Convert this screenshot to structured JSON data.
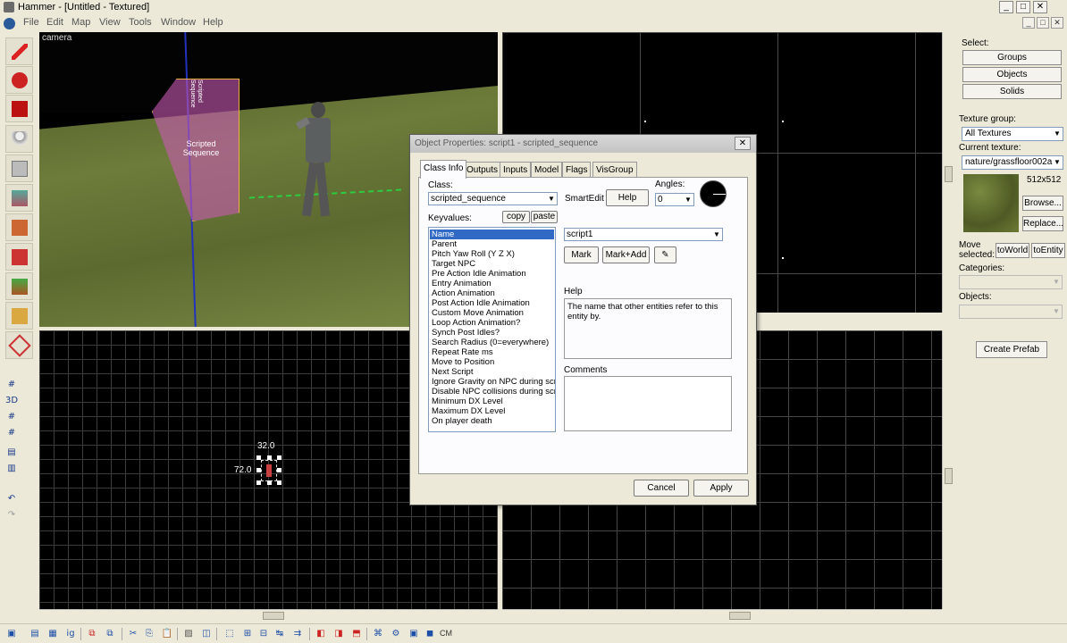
{
  "window": {
    "title": "Hammer - [Untitled - Textured]",
    "controls": {
      "minimize": "_",
      "maximize": "□",
      "close": "✕"
    }
  },
  "menu": [
    "File",
    "Edit",
    "Map",
    "View",
    "Tools",
    "Window",
    "Help"
  ],
  "viewports": {
    "camera_label": "camera",
    "top_view": {
      "width_label": "32.0",
      "height_label": "72.0"
    }
  },
  "entity_box": {
    "line1": "Scripted",
    "line2": "Sequence",
    "top_text": "Scripted Sequence"
  },
  "right_panel": {
    "select_label": "Select:",
    "select_buttons": [
      "Groups",
      "Objects",
      "Solids"
    ],
    "texture_group_label": "Texture group:",
    "texture_group_value": "All Textures",
    "current_texture_label": "Current texture:",
    "current_texture_value": "nature/grassfloor002a",
    "texture_size": "512x512",
    "browse_button": "Browse...",
    "replace_button": "Replace...",
    "move_selected_label": "Move selected:",
    "to_world_button": "toWorld",
    "to_entity_button": "toEntity",
    "categories_label": "Categories:",
    "objects_label": "Objects:",
    "create_prefab_button": "Create Prefab"
  },
  "dialog": {
    "title": "Object Properties: script1 - scripted_sequence",
    "close": "✕",
    "tabs": [
      "Class Info",
      "Outputs",
      "Inputs",
      "Model",
      "Flags",
      "VisGroup"
    ],
    "active_tab": "Class Info",
    "class_label": "Class:",
    "class_value": "scripted_sequence",
    "smartedit_button": "SmartEdit",
    "help_button": "Help",
    "angles_label": "Angles:",
    "angles_value": "0",
    "keyvalues_label": "Keyvalues:",
    "copy_button": "copy",
    "paste_button": "paste",
    "keyvalues": [
      "Name",
      "Parent",
      "Pitch Yaw Roll (Y Z X)",
      "Target NPC",
      "Pre Action Idle Animation",
      "Entry Animation",
      "Action Animation",
      "Post Action Idle Animation",
      "Custom Move Animation",
      "Loop Action Animation?",
      "Synch Post Idles?",
      "Search Radius (0=everywhere)",
      "Repeat Rate ms",
      "Move to Position",
      "Next Script",
      "Ignore Gravity on NPC during script",
      "Disable NPC collisions during script",
      "Minimum DX Level",
      "Maximum DX Level",
      "On player death"
    ],
    "selected_key": "Name",
    "value_field": "script1",
    "mark_button": "Mark",
    "mark_add_button": "Mark+Add",
    "help_label": "Help",
    "help_text": "The name that other entities refer to this entity by.",
    "comments_label": "Comments",
    "comments_text": "",
    "cancel_button": "Cancel",
    "apply_button": "Apply"
  },
  "bottom_toolbar": {
    "cm_label": "CM"
  },
  "colors": {
    "selection": "#316ac5",
    "entity_box": "#c85ab4",
    "grid": "#3c3c3c"
  }
}
